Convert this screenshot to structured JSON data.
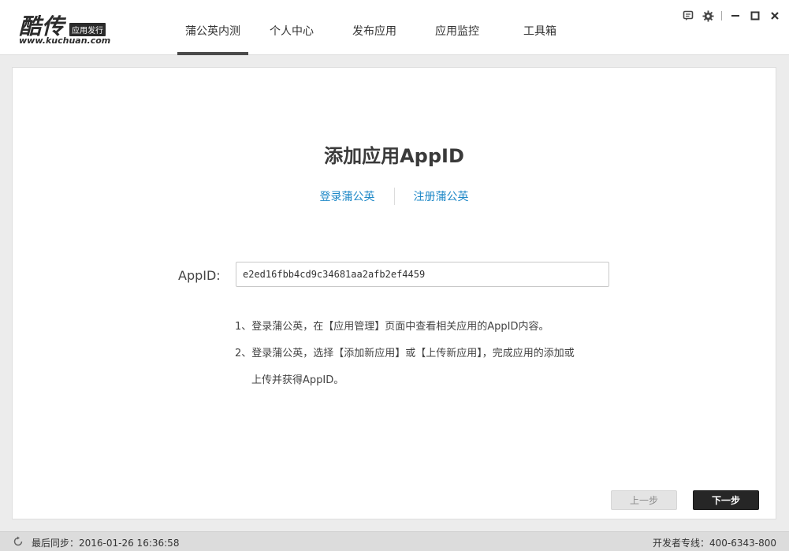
{
  "logo": {
    "main": "酷传",
    "badge": "应用发行",
    "url": "www.kuchuan.com"
  },
  "nav": [
    {
      "label": "蒲公英内测",
      "active": true
    },
    {
      "label": "个人中心",
      "active": false
    },
    {
      "label": "发布应用",
      "active": false
    },
    {
      "label": "应用监控",
      "active": false
    },
    {
      "label": "工具箱",
      "active": false
    }
  ],
  "window_controls": [
    "feedback-icon",
    "settings-icon",
    "minimize-icon",
    "maximize-icon",
    "close-icon"
  ],
  "page": {
    "title": "添加应用AppID",
    "login_link": "登录蒲公英",
    "register_link": "注册蒲公英",
    "field_label": "AppID:",
    "field_value": "e2ed16fbb4cd9c34681aa2afb2ef4459",
    "notes": [
      "1、登录蒲公英，在【应用管理】页面中查看相关应用的AppID内容。",
      "2、登录蒲公英，选择【添加新应用】或【上传新应用】，完成应用的添加或",
      "上传并获得AppID。"
    ],
    "prev_button": "上一步",
    "next_button": "下一步"
  },
  "status": {
    "last_sync": "最后同步：2016-01-26 16:36:58",
    "hotline": "开发者专线：400-6343-800"
  },
  "colors": {
    "link": "#1e88c7",
    "next_button": "#262626",
    "nav_active_bar": "#4a4a4a"
  }
}
